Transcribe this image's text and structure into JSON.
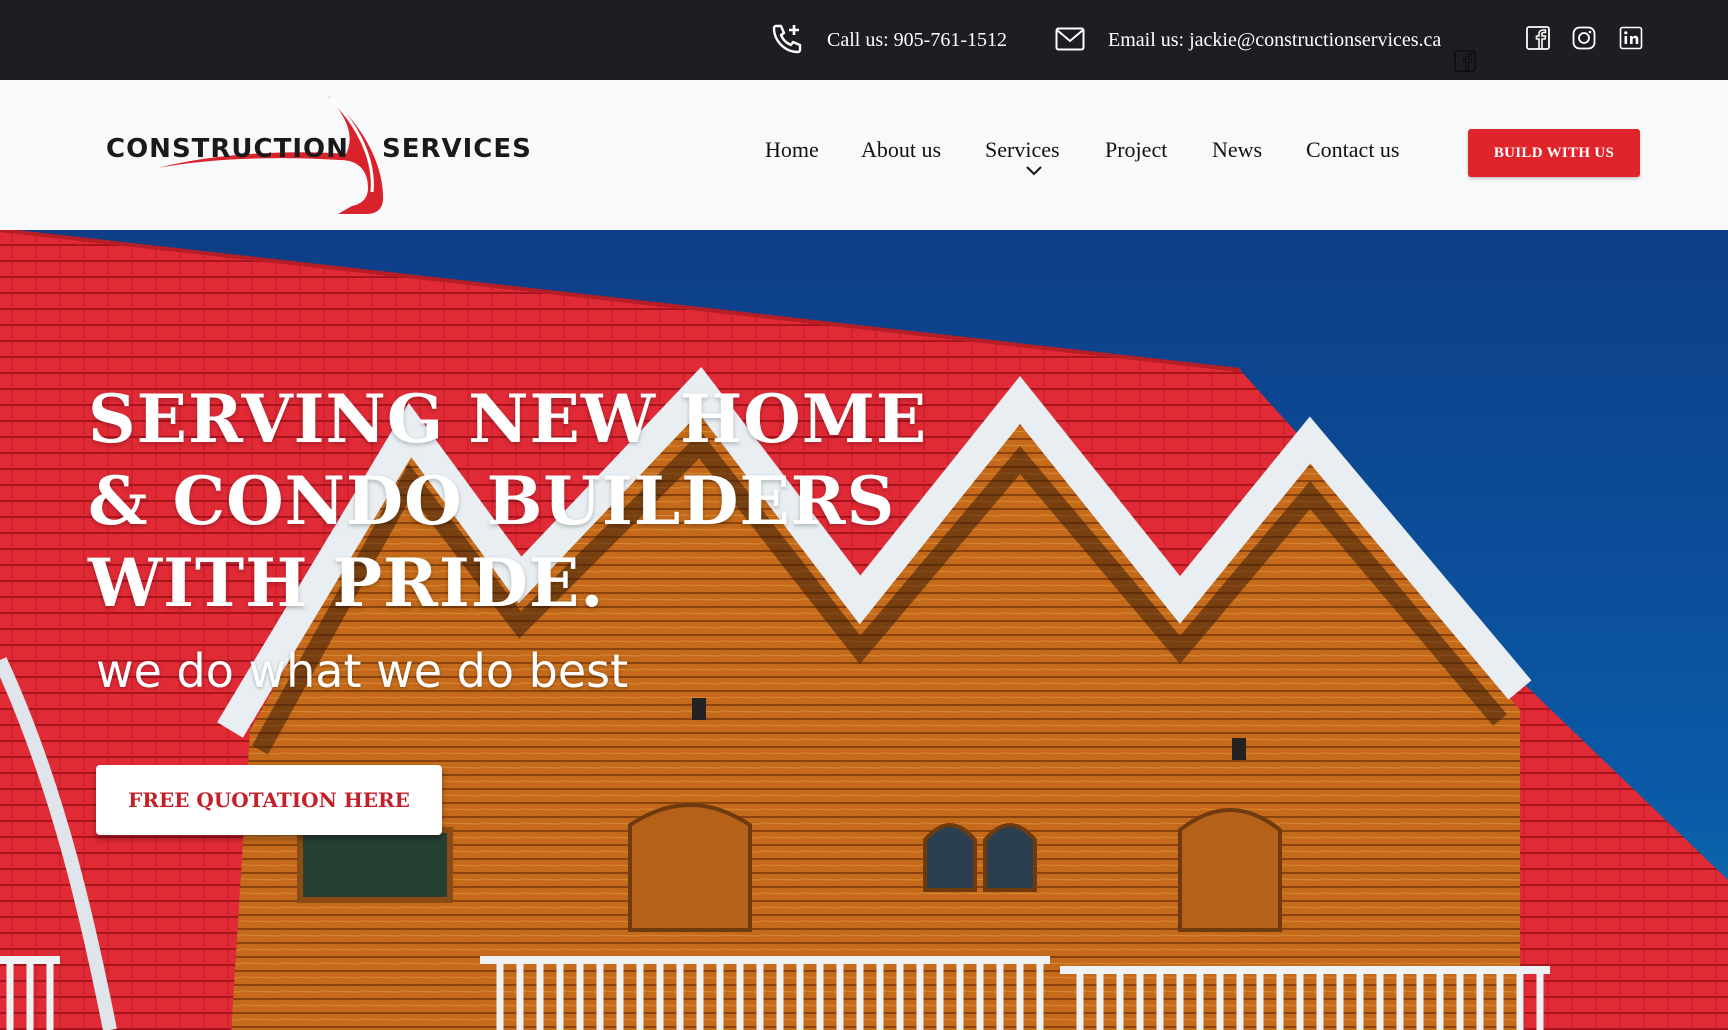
{
  "topbar": {
    "phone_label": "Call us: 905-761-1512",
    "email_label": "Email us: jackie@constructionservices.ca",
    "social": [
      "facebook-icon",
      "instagram-icon",
      "linkedin-icon"
    ]
  },
  "logo": {
    "word1": "Construction",
    "word2": "Services"
  },
  "nav": {
    "items": [
      "Home",
      "About us",
      "Services",
      "Project",
      "News",
      "Contact us"
    ],
    "cta": "BUILD WITH US"
  },
  "hero": {
    "headline": [
      "SERVING NEW HOME",
      "& CONDO BUILDERS",
      "WITH PRIDE."
    ],
    "tagline": "we do what we do best",
    "cta": "FREE QUOTATION HERE"
  },
  "colors": {
    "accent": "#e0242c",
    "topbar": "#1d1e21",
    "roof": "#e02a36",
    "sky": "#0c4d99"
  }
}
